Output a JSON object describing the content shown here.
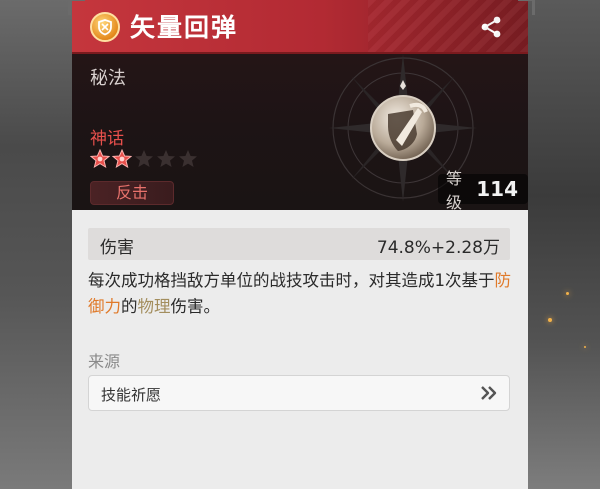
{
  "skill": {
    "title": "矢量回弹",
    "category": "秘法",
    "rarity": "神话",
    "stars_filled": 2,
    "stars_total": 5,
    "tag": "反击",
    "level_label": "等级",
    "level_value": "114"
  },
  "stats": {
    "damage_label": "伤害",
    "damage_value": "74.8%+2.28万"
  },
  "description": {
    "part1": "每次成功格挡敌方单位的战技攻击时，对其造成1次基于",
    "keyword1": "防御力",
    "part2": "的",
    "keyword2": "物理",
    "part3": "伤害。"
  },
  "source": {
    "label": "来源",
    "button_text": "技能祈愿"
  },
  "colors": {
    "title_bar": "#c5363d",
    "rarity": "#e8504c",
    "keyword_orange": "#e07a2a",
    "keyword_brown": "#a38e5e"
  },
  "icons": {
    "skill_type": "sword-shield-icon",
    "share": "share-icon",
    "source_arrow": "double-chevron-right-icon"
  }
}
